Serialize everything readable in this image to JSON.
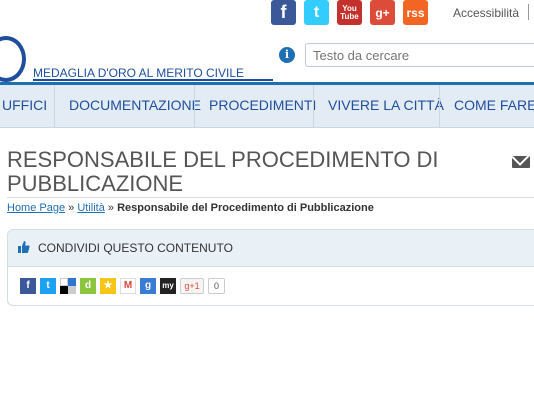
{
  "social": {
    "facebook_glyph": "f",
    "twitter_glyph": "t",
    "youtube_line1": "You",
    "youtube_line2": "Tube",
    "googleplus_glyph": "g+",
    "rss_glyph": "rss"
  },
  "header": {
    "accessibility_label": "Accessibilità",
    "logo_text": "MEDAGLIA D'ORO AL MERITO CIVILE",
    "search_placeholder": "Testo da cercare",
    "info_glyph": "i"
  },
  "nav": {
    "items": [
      "UFFICI",
      "DOCUMENTAZIONE",
      "PROCEDIMENTI",
      "VIVERE LA CITTÀ",
      "COME FARE P"
    ]
  },
  "page": {
    "title": "RESPONSABILE DEL PROCEDIMENTO DI PUBBLICAZIONE",
    "breadcrumb": {
      "home": "Home Page",
      "sep": "»",
      "parent": "Utilità",
      "current": "Responsabile del Procedimento di Pubblicazione"
    }
  },
  "share": {
    "title": "CONDIVIDI QUESTO CONTENUTO",
    "buttons": [
      {
        "name": "facebook",
        "glyph": "f",
        "color": "#3b5998"
      },
      {
        "name": "twitter",
        "glyph": "t",
        "color": "#1da1f2"
      },
      {
        "name": "delicious",
        "glyph": "",
        "color": "#000000"
      },
      {
        "name": "diigo",
        "glyph": "d",
        "color": "#8cc63f"
      },
      {
        "name": "favorites",
        "glyph": "★",
        "color": "#f5c518"
      },
      {
        "name": "gmail",
        "glyph": "M",
        "color": "#d44638"
      },
      {
        "name": "google",
        "glyph": "g",
        "color": "#3a7bd5"
      },
      {
        "name": "myspace",
        "glyph": "my",
        "color": "#222222"
      }
    ],
    "gplus_label": "g+1",
    "gplus_count": "0"
  }
}
